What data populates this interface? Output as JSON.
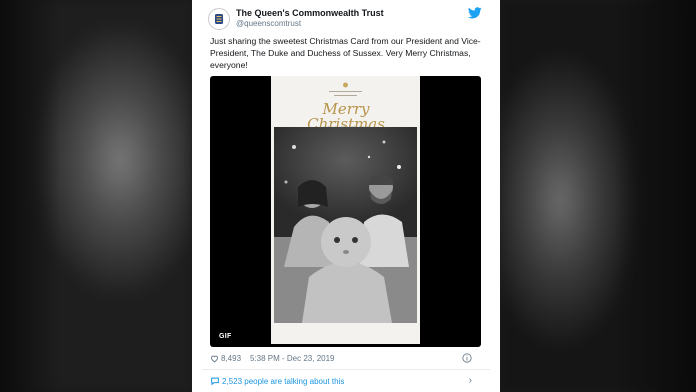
{
  "account": {
    "name": "The Queen's Commonwealth Trust",
    "handle": "@queenscomtrust"
  },
  "tweet": {
    "text": "Just sharing the sweetest Christmas Card from our President and Vice-President, The Duke and Duchess of Sussex. Very Merry Christmas, everyone!"
  },
  "media": {
    "badge": "GIF",
    "card_greeting": "Merry Christmas",
    "card_subtext": "AND A HAPPY NEW YEAR"
  },
  "stats": {
    "likes": "8,493",
    "timestamp": "5:38 PM - Dec 23, 2019"
  },
  "conversation": {
    "text": "2,523 people are talking about this"
  },
  "colors": {
    "twitter_blue": "#1da1f2",
    "link_blue": "#1b95e0",
    "gold": "#b8944a"
  },
  "icons": [
    "twitter-bird-icon",
    "heart-icon",
    "info-icon",
    "reply-bubble-icon",
    "chevron-right-icon"
  ]
}
